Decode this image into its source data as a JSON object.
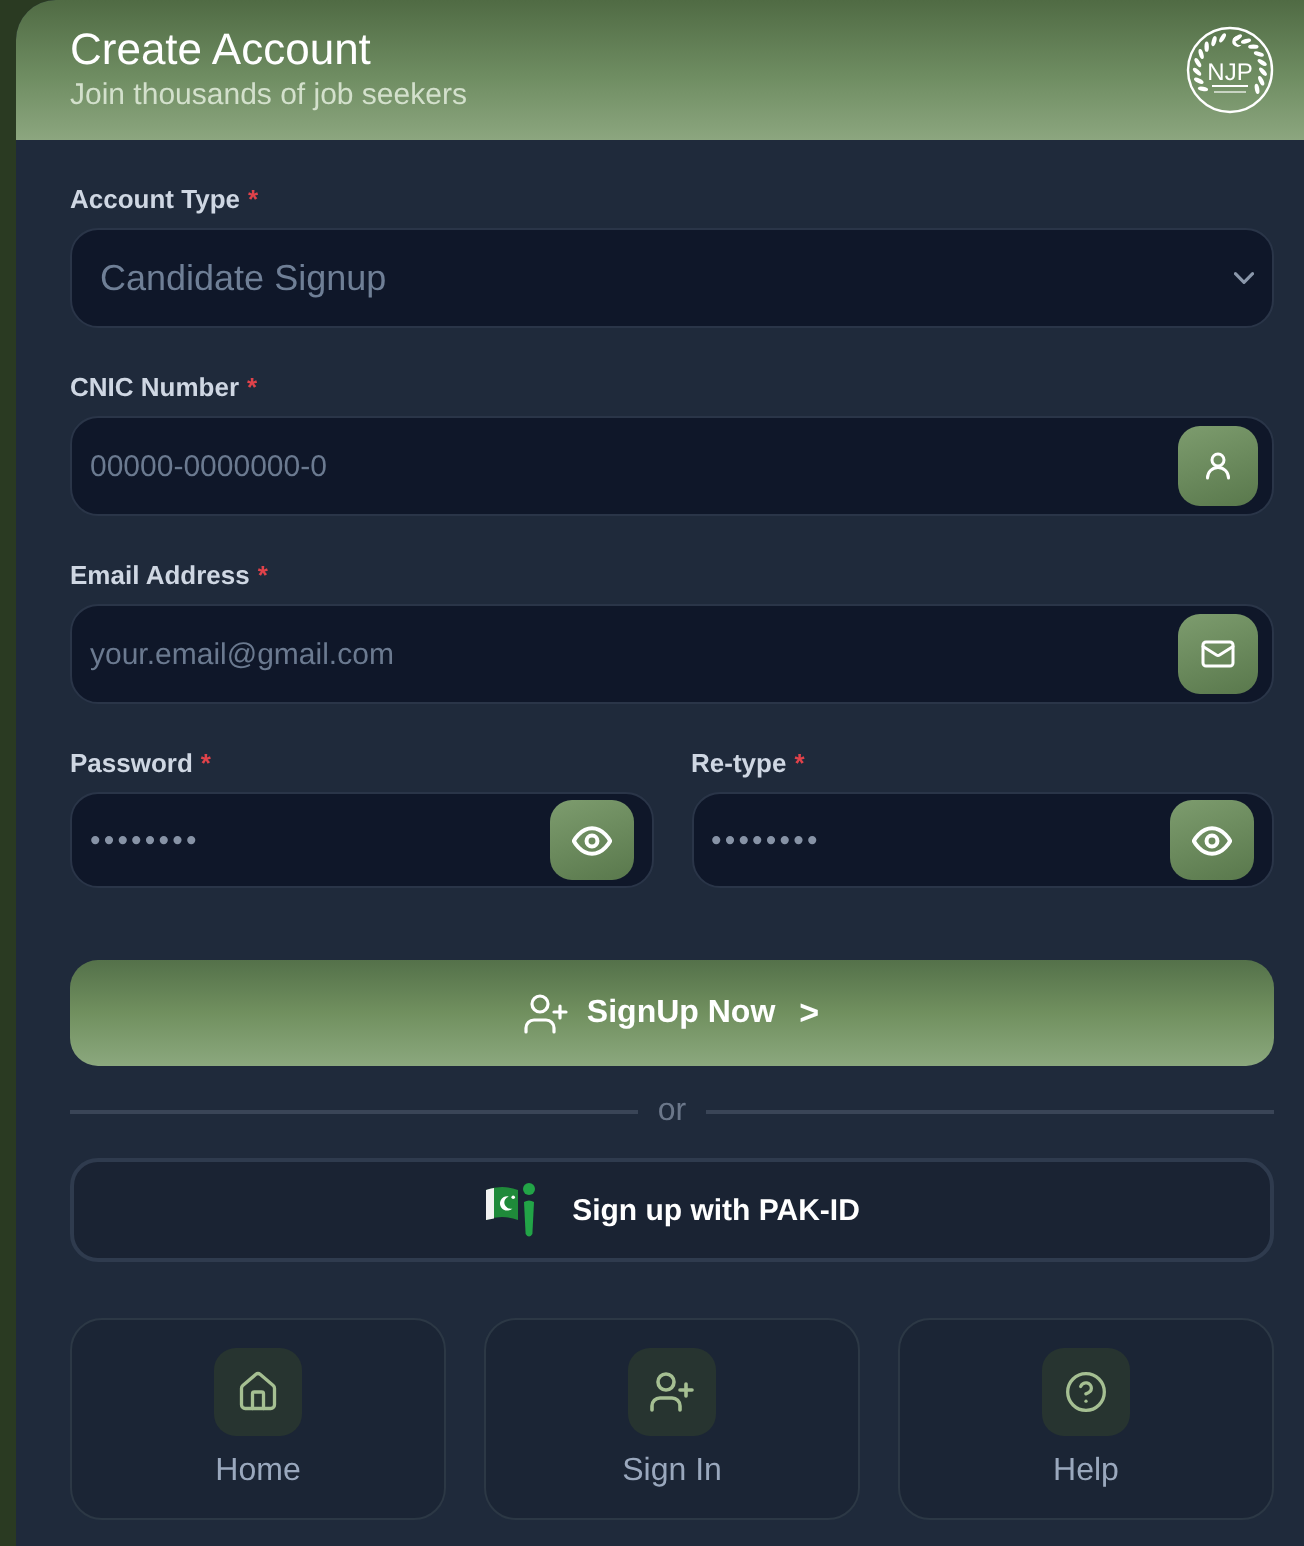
{
  "header": {
    "title": "Create Account",
    "subtitle": "Join thousands of job seekers",
    "logo_text": "NJP"
  },
  "form": {
    "rows": [
      [
        {
          "kind": "select",
          "label": "Account Type",
          "required_mark": "*",
          "value": "Candidate Signup"
        }
      ],
      [
        {
          "kind": "cnic",
          "label": "CNIC Number",
          "required_mark": "*",
          "placeholder": "00000-0000000-0"
        }
      ],
      [
        {
          "kind": "email",
          "label": "Email Address",
          "required_mark": "*",
          "placeholder": "your.email@gmail.com"
        }
      ],
      [
        {
          "kind": "password",
          "label": "Password",
          "required_mark": "*",
          "placeholder": "••••••••"
        },
        {
          "kind": "password",
          "label": "Re-type",
          "required_mark": "*",
          "placeholder": "••••••••"
        }
      ]
    ],
    "submit": {
      "label": "SignUp Now",
      "chevron": ">"
    },
    "divider": "or",
    "pak_id_button": {
      "label": "Sign up with PAK-ID"
    }
  },
  "nav": [
    {
      "kind": "home",
      "label": "Home"
    },
    {
      "kind": "sign-in",
      "label": "Sign In"
    },
    {
      "kind": "help",
      "label": "Help"
    }
  ]
}
